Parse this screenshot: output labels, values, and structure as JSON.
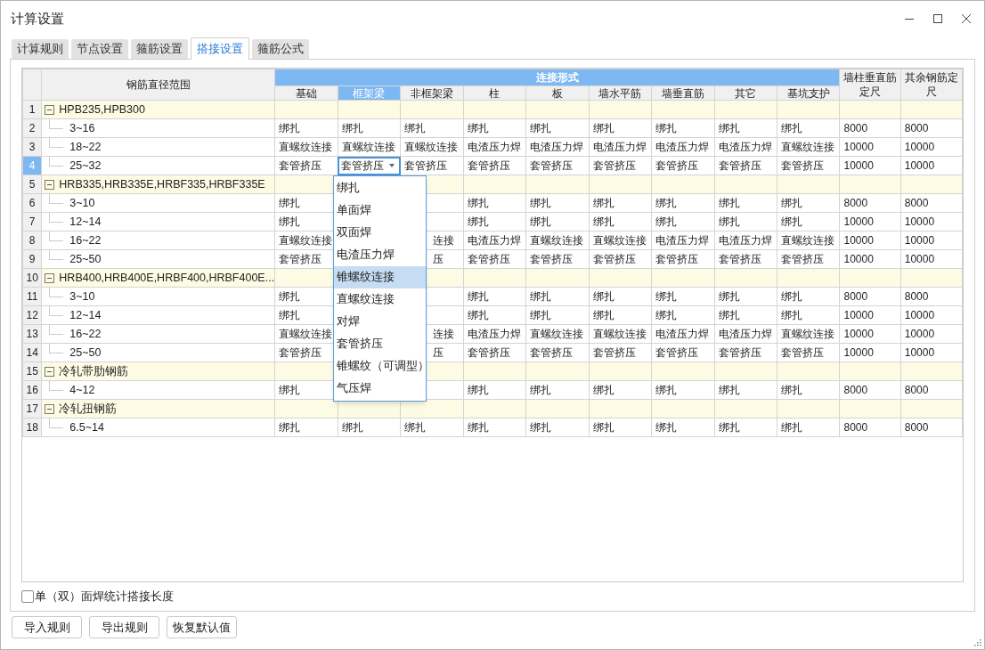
{
  "window": {
    "title": "计算设置"
  },
  "tabs": [
    {
      "label": "计算规则",
      "selected": false
    },
    {
      "label": "节点设置",
      "selected": false
    },
    {
      "label": "箍筋设置",
      "selected": false
    },
    {
      "label": "搭接设置",
      "selected": true
    },
    {
      "label": "箍筋公式",
      "selected": false
    }
  ],
  "table": {
    "name_header": "钢筋直径范围",
    "group_header": "连接形式",
    "columns": [
      {
        "label": "基础",
        "selected": false
      },
      {
        "label": "框架梁",
        "selected": true
      },
      {
        "label": "非框架梁",
        "selected": false
      },
      {
        "label": "柱",
        "selected": false
      },
      {
        "label": "板",
        "selected": false
      },
      {
        "label": "墙水平筋",
        "selected": false
      },
      {
        "label": "墙垂直筋",
        "selected": false
      },
      {
        "label": "其它",
        "selected": false
      },
      {
        "label": "基坑支护",
        "selected": false
      }
    ],
    "extra_columns": [
      "墙柱垂直筋定尺",
      "其余钢筋定尺"
    ],
    "rows": [
      {
        "number": "1",
        "kind": "group",
        "label": "HPB235,HPB300",
        "expanded": true,
        "selected": false
      },
      {
        "number": "2",
        "kind": "item",
        "label": "3~16",
        "selected": false,
        "cells": [
          "绑扎",
          "绑扎",
          "绑扎",
          "绑扎",
          "绑扎",
          "绑扎",
          "绑扎",
          "绑扎",
          "绑扎",
          "8000",
          "8000"
        ]
      },
      {
        "number": "3",
        "kind": "item",
        "label": "18~22",
        "selected": false,
        "cells": [
          "直螺纹连接",
          "直螺纹连接",
          "直螺纹连接",
          "电渣压力焊",
          "电渣压力焊",
          "电渣压力焊",
          "电渣压力焊",
          "电渣压力焊",
          "直螺纹连接",
          "10000",
          "10000"
        ]
      },
      {
        "number": "4",
        "kind": "item",
        "label": "25~32",
        "selected": true,
        "cells": [
          "套管挤压",
          "套管挤压",
          "套管挤压",
          "套管挤压",
          "套管挤压",
          "套管挤压",
          "套管挤压",
          "套管挤压",
          "套管挤压",
          "10000",
          "10000"
        ]
      },
      {
        "number": "5",
        "kind": "group",
        "label": "HRB335,HRB335E,HRBF335,HRBF335E",
        "expanded": true,
        "selected": false
      },
      {
        "number": "6",
        "kind": "item",
        "label": "3~10",
        "selected": false,
        "cells": [
          "绑扎",
          null,
          null,
          "绑扎",
          "绑扎",
          "绑扎",
          "绑扎",
          "绑扎",
          "绑扎",
          "8000",
          "8000"
        ]
      },
      {
        "number": "7",
        "kind": "item",
        "label": "12~14",
        "selected": false,
        "cells": [
          "绑扎",
          null,
          null,
          "绑扎",
          "绑扎",
          "绑扎",
          "绑扎",
          "绑扎",
          "绑扎",
          "10000",
          "10000"
        ]
      },
      {
        "number": "8",
        "kind": "item",
        "label": "16~22",
        "selected": false,
        "cells": [
          "直螺纹连接",
          null,
          "连接",
          "电渣压力焊",
          "直螺纹连接",
          "直螺纹连接",
          "电渣压力焊",
          "电渣压力焊",
          "直螺纹连接",
          "10000",
          "10000"
        ]
      },
      {
        "number": "9",
        "kind": "item",
        "label": "25~50",
        "selected": false,
        "cells": [
          "套管挤压",
          null,
          "压",
          "套管挤压",
          "套管挤压",
          "套管挤压",
          "套管挤压",
          "套管挤压",
          "套管挤压",
          "10000",
          "10000"
        ]
      },
      {
        "number": "10",
        "kind": "group",
        "label": "HRB400,HRB400E,HRBF400,HRBF400E...",
        "expanded": true,
        "selected": false
      },
      {
        "number": "11",
        "kind": "item",
        "label": "3~10",
        "selected": false,
        "cells": [
          "绑扎",
          null,
          null,
          "绑扎",
          "绑扎",
          "绑扎",
          "绑扎",
          "绑扎",
          "绑扎",
          "8000",
          "8000"
        ]
      },
      {
        "number": "12",
        "kind": "item",
        "label": "12~14",
        "selected": false,
        "cells": [
          "绑扎",
          null,
          null,
          "绑扎",
          "绑扎",
          "绑扎",
          "绑扎",
          "绑扎",
          "绑扎",
          "10000",
          "10000"
        ]
      },
      {
        "number": "13",
        "kind": "item",
        "label": "16~22",
        "selected": false,
        "cells": [
          "直螺纹连接",
          null,
          "连接",
          "电渣压力焊",
          "直螺纹连接",
          "直螺纹连接",
          "电渣压力焊",
          "电渣压力焊",
          "直螺纹连接",
          "10000",
          "10000"
        ]
      },
      {
        "number": "14",
        "kind": "item",
        "label": "25~50",
        "selected": false,
        "cells": [
          "套管挤压",
          null,
          "压",
          "套管挤压",
          "套管挤压",
          "套管挤压",
          "套管挤压",
          "套管挤压",
          "套管挤压",
          "10000",
          "10000"
        ]
      },
      {
        "number": "15",
        "kind": "group",
        "label": "冷轧带肋钢筋",
        "expanded": true,
        "selected": false
      },
      {
        "number": "16",
        "kind": "item",
        "label": "4~12",
        "selected": false,
        "cells": [
          "绑扎",
          null,
          null,
          "绑扎",
          "绑扎",
          "绑扎",
          "绑扎",
          "绑扎",
          "绑扎",
          "8000",
          "8000"
        ]
      },
      {
        "number": "17",
        "kind": "group",
        "label": "冷轧扭钢筋",
        "expanded": true,
        "selected": false
      },
      {
        "number": "18",
        "kind": "item",
        "label": "6.5~14",
        "selected": false,
        "cells": [
          "绑扎",
          "绑扎",
          "绑扎",
          "绑扎",
          "绑扎",
          "绑扎",
          "绑扎",
          "绑扎",
          "绑扎",
          "8000",
          "8000"
        ]
      }
    ]
  },
  "dropdown": {
    "options": [
      {
        "label": "绑扎",
        "selected": false
      },
      {
        "label": "单面焊",
        "selected": false
      },
      {
        "label": "双面焊",
        "selected": false
      },
      {
        "label": "电渣压力焊",
        "selected": false
      },
      {
        "label": "锥螺纹连接",
        "selected": true
      },
      {
        "label": "直螺纹连接",
        "selected": false
      },
      {
        "label": "对焊",
        "selected": false
      },
      {
        "label": "套管挤压",
        "selected": false
      },
      {
        "label": "锥螺纹（可调型）",
        "selected": false
      },
      {
        "label": "气压焊",
        "selected": false
      }
    ]
  },
  "checkbox": {
    "label": "单（双）面焊统计搭接长度",
    "checked": false
  },
  "buttons": [
    "导入规则",
    "导出规则",
    "恢复默认值"
  ]
}
